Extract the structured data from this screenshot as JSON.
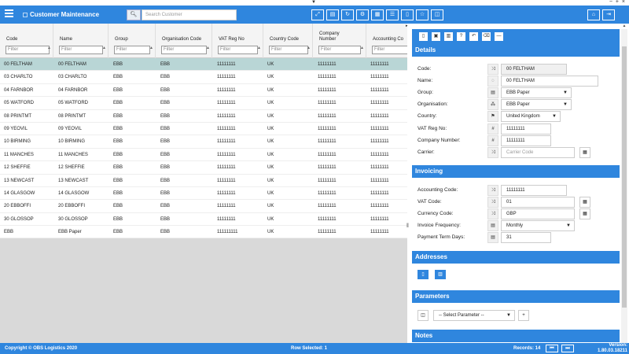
{
  "app": {
    "title": "Customer Maintenance",
    "window_controls": "− + ×",
    "top_marker": "▼"
  },
  "search": {
    "placeholder": "Search Customer",
    "icon": "search-icon"
  },
  "toolbar": {
    "buttons": [
      {
        "name": "expand",
        "glyph": "⤢"
      },
      {
        "name": "database",
        "glyph": "▤"
      },
      {
        "name": "refresh",
        "glyph": "↻"
      },
      {
        "name": "settings",
        "glyph": "⚙"
      },
      {
        "name": "grid",
        "glyph": "▦"
      },
      {
        "name": "list",
        "glyph": "☰"
      },
      {
        "name": "document",
        "glyph": "▯"
      },
      {
        "name": "star",
        "glyph": "☆"
      },
      {
        "name": "columns",
        "glyph": "◫"
      }
    ],
    "right_buttons": [
      {
        "name": "home",
        "glyph": "⌂"
      },
      {
        "name": "exit",
        "glyph": "⇥"
      }
    ]
  },
  "grid": {
    "filter_placeholder": "Filter",
    "columns": [
      {
        "label": "Code"
      },
      {
        "label": "Name"
      },
      {
        "label": "Group"
      },
      {
        "label": "Organisation Code"
      },
      {
        "label": "VAT Reg No"
      },
      {
        "label": "Country Code"
      },
      {
        "label": "Company Number"
      },
      {
        "label": "Accounting Co"
      }
    ],
    "rows": [
      [
        "00 FELTHAM",
        "00 FELTHAM",
        "EBB",
        "EBB",
        "11111111",
        "UK",
        "11111111",
        "11111111"
      ],
      [
        "03 CHARLTO",
        "03 CHARLTO",
        "EBB",
        "EBB",
        "11111111",
        "UK",
        "11111111",
        "11111111"
      ],
      [
        "04 FARNBOR",
        "04 FARNBOR",
        "EBB",
        "EBB",
        "11111111",
        "UK",
        "11111111",
        "11111111"
      ],
      [
        "05 WATFORD",
        "05 WATFORD",
        "EBB",
        "EBB",
        "11111111",
        "UK",
        "11111111",
        "11111111"
      ],
      [
        "08 PRINTMT",
        "08 PRINTMT",
        "EBB",
        "EBB",
        "11111111",
        "UK",
        "11111111",
        "11111111"
      ],
      [
        "09 YEOVIL",
        "09 YEOVIL",
        "EBB",
        "EBB",
        "11111111",
        "UK",
        "11111111",
        "11111111"
      ],
      [
        "10 BIRMING",
        "10 BIRMING",
        "EBB",
        "EBB",
        "11111111",
        "UK",
        "11111111",
        "11111111"
      ],
      [
        "11 MANCHES",
        "11 MANCHES",
        "EBB",
        "EBB",
        "11111111",
        "UK",
        "11111111",
        "11111111"
      ],
      [
        "12 SHEFFIE",
        "12 SHEFFIE",
        "EBB",
        "EBB",
        "11111111",
        "UK",
        "11111111",
        "11111111"
      ],
      [
        "13 NEWCAST",
        "13 NEWCAST",
        "EBB",
        "EBB",
        "11111111",
        "UK",
        "11111111",
        "11111111"
      ],
      [
        "14 GLASGOW",
        "14 GLASGOW",
        "EBB",
        "EBB",
        "11111111",
        "UK",
        "11111111",
        "11111111"
      ],
      [
        "20 EBBOFFI",
        "20 EBBOFFI",
        "EBB",
        "EBB",
        "11111111",
        "UK",
        "11111111",
        "11111111"
      ],
      [
        "30 GLOSSOP",
        "30 GLOSSOP",
        "EBB",
        "EBB",
        "11111111",
        "UK",
        "11111111",
        "11111111"
      ],
      [
        "EBB",
        "EBB Paper",
        "EBB",
        "EBB",
        "111111111",
        "UK",
        "11111111",
        "11111111"
      ]
    ],
    "selected_row": 0
  },
  "panel": {
    "tool_buttons": [
      {
        "name": "new",
        "glyph": "▯"
      },
      {
        "name": "save",
        "glyph": "▣"
      },
      {
        "name": "delete",
        "glyph": "▥"
      },
      {
        "name": "help",
        "glyph": "?"
      },
      {
        "name": "undo",
        "glyph": "↶"
      },
      {
        "name": "erase",
        "glyph": "⌫"
      },
      {
        "name": "minimize",
        "glyph": "—"
      }
    ],
    "details": {
      "title": "Details",
      "fields": [
        {
          "label": "Code:",
          "icon": "⤨",
          "value": "00 FELTHAM"
        },
        {
          "label": "Name:",
          "icon": "◌",
          "value": "00 FELTHAM"
        },
        {
          "label": "Group:",
          "icon": "▤",
          "value": "EBB Paper"
        },
        {
          "label": "Organisation:",
          "icon": "⁂",
          "value": "EBB Paper"
        },
        {
          "label": "Country:",
          "icon": "⚑",
          "value": "United Kingdom"
        },
        {
          "label": "VAT Reg No:",
          "icon": "#",
          "value": "11111111"
        },
        {
          "label": "Company Number:",
          "icon": "#",
          "value": "11111111"
        },
        {
          "label": "Carrier:",
          "icon": "⤨",
          "value": "Carrier Code"
        }
      ]
    },
    "invoicing": {
      "title": "Invoicing",
      "fields": [
        {
          "label": "Accounting Code:",
          "icon": "⤨",
          "value": "11111111"
        },
        {
          "label": "VAT Code:",
          "icon": "⤨",
          "value": "01"
        },
        {
          "label": "Currency Code:",
          "icon": "⤨",
          "value": "GBP"
        },
        {
          "label": "Invoice Frequency:",
          "icon": "▤",
          "value": "Monthly"
        },
        {
          "label": "Payment Term Days:",
          "icon": "▤",
          "value": "31"
        }
      ]
    },
    "addresses": {
      "title": "Addresses"
    },
    "parameters": {
      "title": "Parameters",
      "select": "-- Select Parameter --"
    },
    "notes": {
      "title": "Notes"
    }
  },
  "footer": {
    "copyright": "Copyright © OBS Logistics 2020",
    "row_selected": "Row Selected: 1",
    "records": "Records: 14",
    "version_label": "Version:",
    "version": "1.80.03.18211"
  }
}
